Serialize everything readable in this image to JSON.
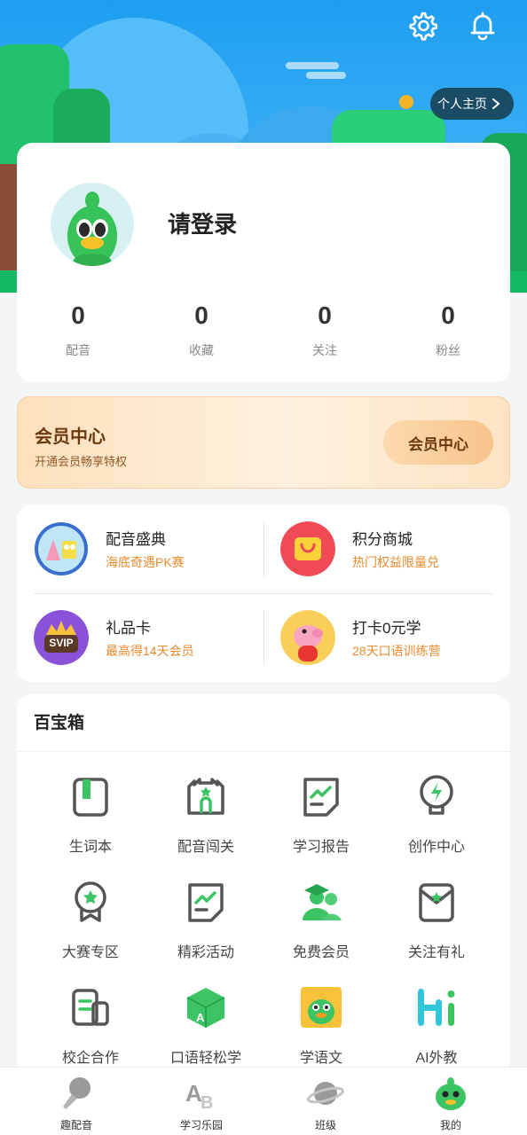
{
  "header": {
    "settings_icon": "gear-icon",
    "notification_icon": "bell-icon",
    "profile_link": "个人主页"
  },
  "user": {
    "login_prompt": "请登录",
    "stats": [
      {
        "value": "0",
        "label": "配音"
      },
      {
        "value": "0",
        "label": "收藏"
      },
      {
        "value": "0",
        "label": "关注"
      },
      {
        "value": "0",
        "label": "粉丝"
      }
    ]
  },
  "vip": {
    "title": "会员中心",
    "subtitle": "开通会员畅享特权",
    "button": "会员中心"
  },
  "promos": [
    {
      "title": "配音盛典",
      "subtitle": "海底奇遇PK赛"
    },
    {
      "title": "积分商城",
      "subtitle": "热门权益限量兑"
    },
    {
      "title": "礼品卡",
      "subtitle": "最高得14天会员",
      "badge": "SVIP"
    },
    {
      "title": "打卡0元学",
      "subtitle": "28天口语训练营"
    }
  ],
  "toolbox": {
    "title": "百宝箱",
    "items": [
      {
        "label": "生词本",
        "icon": "vocabulary-book-icon"
      },
      {
        "label": "配音闯关",
        "icon": "castle-icon"
      },
      {
        "label": "学习报告",
        "icon": "report-icon"
      },
      {
        "label": "创作中心",
        "icon": "lightbulb-icon"
      },
      {
        "label": "大赛专区",
        "icon": "medal-icon"
      },
      {
        "label": "精彩活动",
        "icon": "activity-icon"
      },
      {
        "label": "免费会员",
        "icon": "free-member-icon"
      },
      {
        "label": "关注有礼",
        "icon": "gift-envelope-icon"
      },
      {
        "label": "校企合作",
        "icon": "cooperation-icon"
      },
      {
        "label": "口语轻松学",
        "icon": "cube-a-icon"
      },
      {
        "label": "学语文",
        "icon": "chinese-duck-icon"
      },
      {
        "label": "AI外教",
        "icon": "hi-icon"
      }
    ]
  },
  "nav": [
    {
      "label": "趣配音",
      "icon": "microphone-icon"
    },
    {
      "label": "学习乐园",
      "icon": "abc-icon"
    },
    {
      "label": "班级",
      "icon": "planet-icon"
    },
    {
      "label": "我的",
      "icon": "mascot-icon",
      "active": true
    }
  ],
  "colors": {
    "accent_green": "#3cc464",
    "promo_orange": "#e98a2c",
    "vip_brown": "#6b3a10"
  }
}
